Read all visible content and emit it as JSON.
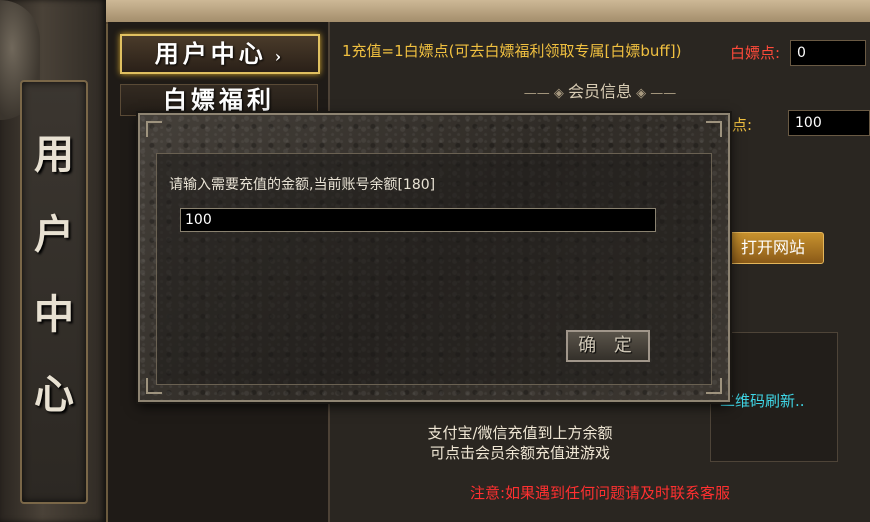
{
  "left_banner": {
    "chars": [
      "用",
      "户",
      "中",
      "心"
    ]
  },
  "nav": {
    "user_center": "用户中心",
    "user_center_arrow": "›",
    "welfare": "白嫖福利"
  },
  "main": {
    "recharge_info": "1充值=1白嫖点(可去白嫖福利领取专属[白嫖buff])",
    "points_label": "白嫖点:",
    "points_value": "0",
    "member_info_title": "会员信息",
    "balance_label_partial": "点:",
    "balance_value": "100",
    "open_site_button": "打开网站",
    "qr_refresh_text": "二维码刷新..",
    "pay_line1": "支付宝/微信充值到上方余额",
    "pay_line2": "可点击会员余额充值进游戏",
    "notice": "注意:如果遇到任何问题请及时联系客服"
  },
  "modal": {
    "prompt": "请输入需要充值的金额,当前账号余额[180]",
    "input_value": "100",
    "confirm_button": "确 定"
  },
  "colors": {
    "gold_text": "#f0c040",
    "red_text": "#ff3030",
    "cyan_text": "#3fd6e6",
    "highlight_border": "#e0c060"
  }
}
